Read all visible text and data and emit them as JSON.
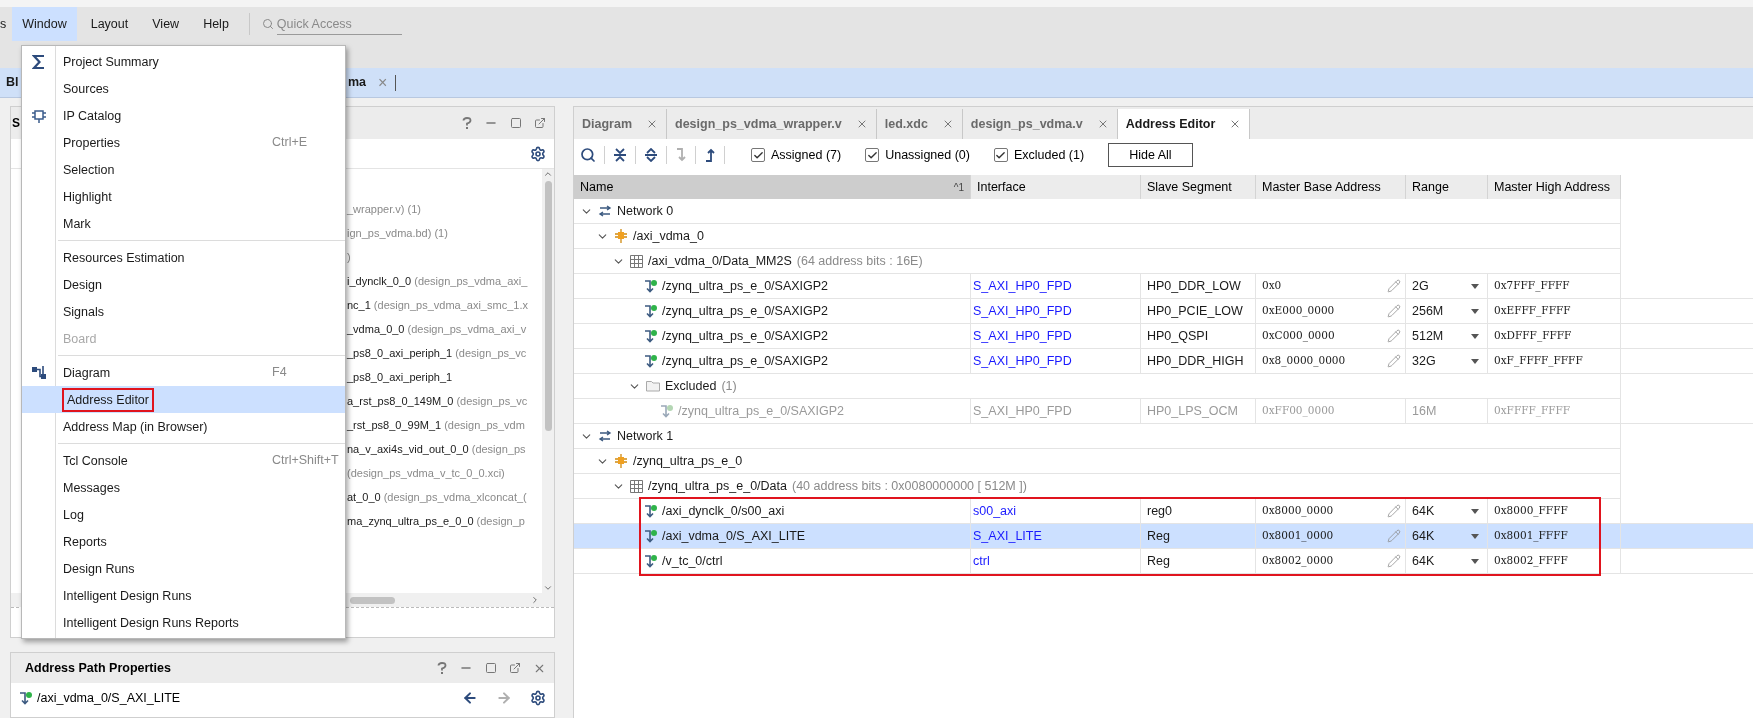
{
  "menubar": {
    "items": [
      {
        "label": "s",
        "selected": false
      },
      {
        "label": "Window",
        "selected": true
      },
      {
        "label": "Layout",
        "selected": false
      },
      {
        "label": "View",
        "selected": false
      },
      {
        "label": "Help",
        "selected": false
      }
    ],
    "search": {
      "placeholder": "Quick Access"
    }
  },
  "document_tabs": [
    {
      "label": "Bl"
    },
    {
      "label": "ma",
      "close": "×"
    }
  ],
  "window_menu": {
    "items": [
      {
        "kind": "item",
        "label": "Project Summary",
        "selected": false,
        "disabled": false,
        "boxed": false
      },
      {
        "kind": "item",
        "label": "Sources",
        "selected": false,
        "disabled": false,
        "boxed": false
      },
      {
        "kind": "item",
        "label": "IP Catalog",
        "selected": false,
        "disabled": false,
        "boxed": false
      },
      {
        "kind": "item",
        "label": "Properties",
        "shortcut": "Ctrl+E",
        "selected": false,
        "disabled": false,
        "boxed": false
      },
      {
        "kind": "item",
        "label": "Selection",
        "selected": false,
        "disabled": false,
        "boxed": false
      },
      {
        "kind": "item",
        "label": "Highlight",
        "selected": false,
        "disabled": false,
        "boxed": false
      },
      {
        "kind": "item",
        "label": "Mark",
        "selected": false,
        "disabled": false,
        "boxed": false
      },
      {
        "kind": "separator"
      },
      {
        "kind": "item",
        "label": "Resources Estimation",
        "selected": false,
        "disabled": false,
        "boxed": false
      },
      {
        "kind": "item",
        "label": "Design",
        "selected": false,
        "disabled": false,
        "boxed": false
      },
      {
        "kind": "item",
        "label": "Signals",
        "selected": false,
        "disabled": false,
        "boxed": false
      },
      {
        "kind": "item",
        "label": "Board",
        "selected": false,
        "disabled": true,
        "boxed": false
      },
      {
        "kind": "separator"
      },
      {
        "kind": "item",
        "label": "Diagram",
        "shortcut": "F4",
        "selected": false,
        "disabled": false,
        "boxed": false
      },
      {
        "kind": "item",
        "label": "Address Editor",
        "selected": true,
        "disabled": false,
        "boxed": true
      },
      {
        "kind": "item",
        "label": "Address Map (in Browser)",
        "selected": false,
        "disabled": false,
        "boxed": false
      },
      {
        "kind": "separator"
      },
      {
        "kind": "item",
        "label": "Tcl Console",
        "shortcut": "Ctrl+Shift+T",
        "selected": false,
        "disabled": false,
        "boxed": false
      },
      {
        "kind": "item",
        "label": "Messages",
        "selected": false,
        "disabled": false,
        "boxed": false
      },
      {
        "kind": "item",
        "label": "Log",
        "selected": false,
        "disabled": false,
        "boxed": false
      },
      {
        "kind": "item",
        "label": "Reports",
        "selected": false,
        "disabled": false,
        "boxed": false
      },
      {
        "kind": "item",
        "label": "Design Runs",
        "selected": false,
        "disabled": false,
        "boxed": false
      },
      {
        "kind": "item",
        "label": "Intelligent Design Runs",
        "selected": false,
        "disabled": false,
        "boxed": false
      },
      {
        "kind": "item",
        "label": "Intelligent Design Runs Reports",
        "selected": false,
        "disabled": false,
        "boxed": false
      }
    ]
  },
  "sources_panel": {
    "title": "S",
    "rows": [
      {
        "detail": "_wrapper.v) (1)"
      },
      {
        "detail": "ign_ps_vdma.bd) (1)"
      },
      {
        "detail": ")"
      },
      {
        "name": "i_dynclk_0_0",
        "detail": "(design_ps_vdma_axi_"
      },
      {
        "name": "nc_1",
        "detail": "(design_ps_vdma_axi_smc_1.x"
      },
      {
        "name": "_vdma_0_0",
        "detail": "(design_ps_vdma_axi_v"
      },
      {
        "name": "_ps8_0_axi_periph_1",
        "detail": "(design_ps_vc"
      },
      {
        "name": "_ps8_0_axi_periph_1"
      },
      {
        "name": "a_rst_ps8_0_149M_0",
        "detail": "(design_ps_vc"
      },
      {
        "name": "_rst_ps8_0_99M_1",
        "detail": "(design_ps_vdm"
      },
      {
        "name": "na_v_axi4s_vid_out_0_0",
        "detail": "(design_ps"
      },
      {
        "detail": "(design_ps_vdma_v_tc_0_0.xci)"
      },
      {
        "name": "at_0_0",
        "detail": "(design_ps_vdma_xlconcat_("
      },
      {
        "name": "ma_zynq_ultra_ps_e_0_0",
        "detail": "(design_p"
      }
    ]
  },
  "address_path_properties": {
    "title": "Address Path Properties",
    "path": "/axi_vdma_0/S_AXI_LITE"
  },
  "editor_tabs": [
    {
      "label": "Diagram",
      "selected": false
    },
    {
      "label": "design_ps_vdma_wrapper.v",
      "selected": false
    },
    {
      "label": "led.xdc",
      "selected": false
    },
    {
      "label": "design_ps_vdma.v",
      "selected": false
    },
    {
      "label": "Address Editor",
      "selected": true
    }
  ],
  "filters": [
    {
      "label": "Assigned (7)",
      "checked": true
    },
    {
      "label": "Unassigned (0)",
      "checked": true
    },
    {
      "label": "Excluded (1)",
      "checked": true
    }
  ],
  "hide_button": "Hide All",
  "table": {
    "columns": [
      {
        "label": "Name",
        "sort": "^1"
      },
      {
        "label": "Interface"
      },
      {
        "label": "Slave Segment"
      },
      {
        "label": "Master Base Address"
      },
      {
        "label": "Range"
      },
      {
        "label": "Master High Address"
      }
    ],
    "rows": [
      {
        "kind": "network",
        "name": "Network 0",
        "expanded": true,
        "children": [
          {
            "kind": "instance",
            "name": "/axi_vdma_0",
            "expanded": true,
            "children": [
              {
                "kind": "space",
                "name": "/axi_vdma_0/Data_MM2S",
                "detail": "(64 address bits : 16E)",
                "expanded": true,
                "boxed": false,
                "children": [
                  {
                    "kind": "segment",
                    "name": "/zynq_ultra_ps_e_0/SAXIGP2",
                    "interface": "S_AXI_HP0_FPD",
                    "slave_segment": "HP0_DDR_LOW",
                    "base": "0x0",
                    "range": "2G",
                    "high": "0x7FFF_FFFF",
                    "selected": false,
                    "excluded": false
                  },
                  {
                    "kind": "segment",
                    "name": "/zynq_ultra_ps_e_0/SAXIGP2",
                    "interface": "S_AXI_HP0_FPD",
                    "slave_segment": "HP0_PCIE_LOW",
                    "base": "0xE000_0000",
                    "range": "256M",
                    "high": "0xEFFF_FFFF",
                    "selected": false,
                    "excluded": false
                  },
                  {
                    "kind": "segment",
                    "name": "/zynq_ultra_ps_e_0/SAXIGP2",
                    "interface": "S_AXI_HP0_FPD",
                    "slave_segment": "HP0_QSPI",
                    "base": "0xC000_0000",
                    "range": "512M",
                    "high": "0xDFFF_FFFF",
                    "selected": false,
                    "excluded": false
                  },
                  {
                    "kind": "segment",
                    "name": "/zynq_ultra_ps_e_0/SAXIGP2",
                    "interface": "S_AXI_HP0_FPD",
                    "slave_segment": "HP0_DDR_HIGH",
                    "base": "0x8_0000_0000",
                    "range": "32G",
                    "high": "0xF_FFFF_FFFF",
                    "selected": false,
                    "excluded": false
                  },
                  {
                    "kind": "folder",
                    "name": "Excluded",
                    "detail": "(1)",
                    "expanded": true,
                    "children": [
                      {
                        "kind": "segment",
                        "name": "/zynq_ultra_ps_e_0/SAXIGP2",
                        "interface": "S_AXI_HP0_FPD",
                        "slave_segment": "HP0_LPS_OCM",
                        "base": "0xFF00_0000",
                        "range": "16M",
                        "high": "0xFFFF_FFFF",
                        "selected": false,
                        "excluded": true
                      }
                    ]
                  }
                ]
              }
            ]
          }
        ]
      },
      {
        "kind": "network",
        "name": "Network 1",
        "expanded": true,
        "children": [
          {
            "kind": "instance",
            "name": "/zynq_ultra_ps_e_0",
            "expanded": true,
            "children": [
              {
                "kind": "space",
                "name": "/zynq_ultra_ps_e_0/Data",
                "detail": "(40 address bits : 0x0080000000 [ 512M ])",
                "expanded": true,
                "boxed": true,
                "children": [
                  {
                    "kind": "segment",
                    "name": "/axi_dynclk_0/s00_axi",
                    "interface": "s00_axi",
                    "slave_segment": "reg0",
                    "base": "0x8000_0000",
                    "range": "64K",
                    "high": "0x8000_FFFF",
                    "selected": false,
                    "excluded": false
                  },
                  {
                    "kind": "segment",
                    "name": "/axi_vdma_0/S_AXI_LITE",
                    "interface": "S_AXI_LITE",
                    "slave_segment": "Reg",
                    "base": "0x8001_0000",
                    "range": "64K",
                    "high": "0x8001_FFFF",
                    "selected": true,
                    "excluded": false
                  },
                  {
                    "kind": "segment",
                    "name": "/v_tc_0/ctrl",
                    "interface": "ctrl",
                    "slave_segment": "Reg",
                    "base": "0x8002_0000",
                    "range": "64K",
                    "high": "0x8002_FFFF",
                    "selected": false,
                    "excluded": false
                  }
                ]
              }
            ]
          }
        ]
      }
    ]
  }
}
